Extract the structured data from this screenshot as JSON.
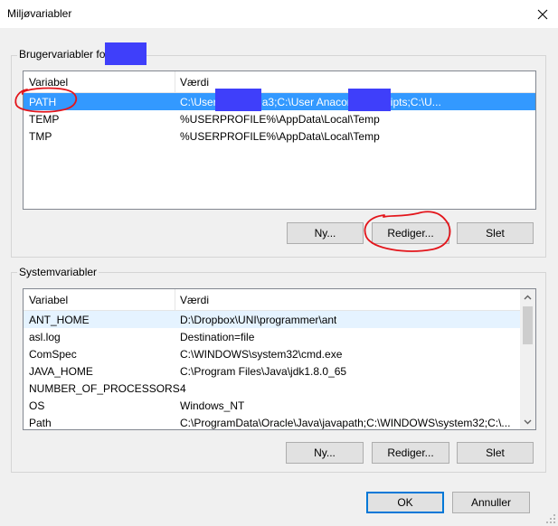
{
  "window": {
    "title": "Miljøvariabler"
  },
  "user_group": {
    "label": "Brugervariabler for",
    "headers": [
      "Variabel",
      "Værdi"
    ],
    "rows": [
      {
        "name": "PATH",
        "value": "C:\\User          Anaconda3;C:\\User          Anaconda3\\Scripts;C:\\U..."
      },
      {
        "name": "TEMP",
        "value": "%USERPROFILE%\\AppData\\Local\\Temp"
      },
      {
        "name": "TMP",
        "value": "%USERPROFILE%\\AppData\\Local\\Temp"
      }
    ],
    "buttons": {
      "new": "Ny...",
      "edit": "Rediger...",
      "delete": "Slet"
    }
  },
  "system_group": {
    "label": "Systemvariabler",
    "headers": [
      "Variabel",
      "Værdi"
    ],
    "rows": [
      {
        "name": "ANT_HOME",
        "value": "D:\\Dropbox\\UNI\\programmer\\ant"
      },
      {
        "name": "asl.log",
        "value": "Destination=file"
      },
      {
        "name": "ComSpec",
        "value": "C:\\WINDOWS\\system32\\cmd.exe"
      },
      {
        "name": "JAVA_HOME",
        "value": "C:\\Program Files\\Java\\jdk1.8.0_65"
      },
      {
        "name": "NUMBER_OF_PROCESSORS",
        "value": "4"
      },
      {
        "name": "OS",
        "value": "Windows_NT"
      },
      {
        "name": "Path",
        "value": "C:\\ProgramData\\Oracle\\Java\\javapath;C:\\WINDOWS\\system32;C:\\..."
      }
    ],
    "buttons": {
      "new": "Ny...",
      "edit": "Rediger...",
      "delete": "Slet"
    }
  },
  "dialog_buttons": {
    "ok": "OK",
    "cancel": "Annuller"
  },
  "icons": {
    "close": "close-icon",
    "scroll_up": "chevron-up-icon",
    "scroll_down": "chevron-down-icon",
    "resize": "resize-grip-icon"
  },
  "colors": {
    "selection": "#3399ff",
    "hover": "#e5f3ff",
    "redaction": "#3f3ffa",
    "annotation": "#e3151b",
    "default_border": "#0078d7"
  }
}
